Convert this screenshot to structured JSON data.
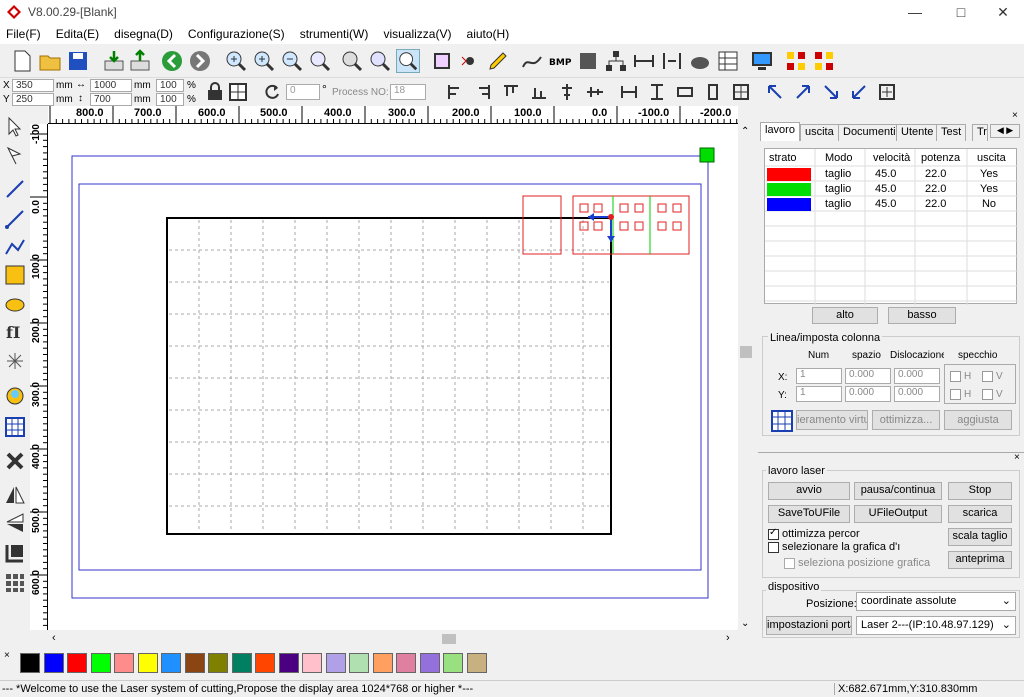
{
  "window": {
    "title": "V8.00.29-[Blank]"
  },
  "menu": [
    "File(F)",
    "Edita(E)",
    "disegna(D)",
    "Configurazione(S)",
    "strumenti(W)",
    "visualizza(V)",
    "aiuto(H)"
  ],
  "toolbar2": {
    "x_label": "X",
    "y_label": "Y",
    "x_val": "350",
    "y_val": "250",
    "unit_mm": "mm",
    "w_val": "1000",
    "h_val": "700",
    "sx_val": "100",
    "sy_val": "100",
    "pct": "%",
    "rotate_val": "0",
    "deg": "°",
    "process_label": "Process NO:",
    "process_val": "18"
  },
  "ruler_top": [
    "800.0",
    "700.0",
    "600.0",
    "500.0",
    "400.0",
    "300.0",
    "200.0",
    "100.0",
    "0.0",
    "-100.0",
    "-200.0"
  ],
  "ruler_left": [
    "-100",
    "0.0",
    "100.0",
    "200.0",
    "300.0",
    "400.0",
    "500.0",
    "600.0"
  ],
  "palette": [
    "#000000",
    "#0000ff",
    "#ff0000",
    "#00ff00",
    "#ff8c8c",
    "#ffff00",
    "#1e90ff",
    "#8b4513",
    "#808000",
    "#008060",
    "#ff4500",
    "#4b0082",
    "#ffc0cb",
    "#b0a0e8",
    "#b0e0b0",
    "#ffa060",
    "#e080a0",
    "#9370db",
    "#98e080",
    "#c8b080"
  ],
  "panel": {
    "tabs": [
      "lavoro",
      "uscita",
      "Documenti",
      "Utente",
      "Test",
      "Tra"
    ],
    "table_headers": [
      "strato",
      "Modo",
      "velocità",
      "potenza",
      "uscita"
    ],
    "layers": [
      {
        "color": "#ff0000",
        "mode": "taglio",
        "speed": "45.0",
        "power": "22.0",
        "out": "Yes"
      },
      {
        "color": "#00dd00",
        "mode": "taglio",
        "speed": "45.0",
        "power": "22.0",
        "out": "Yes"
      },
      {
        "color": "#0000ff",
        "mode": "taglio",
        "speed": "45.0",
        "power": "22.0",
        "out": "No"
      }
    ],
    "btn_up": "alto",
    "btn_down": "basso",
    "array_group": "Linea/imposta colonna",
    "array_headers": [
      "Num",
      "spazio",
      "Dislocazione",
      "specchio"
    ],
    "x_label": "X:",
    "y_label": "Y:",
    "x_num": "1",
    "x_space": "0.000",
    "x_disloc": "0.000",
    "y_num": "1",
    "y_space": "0.000",
    "y_disloc": "0.000",
    "h": "H",
    "v": "V",
    "btn_virtual": "ieramento virtu",
    "btn_optimize": "ottimizza...",
    "btn_adjust": "aggiusta",
    "laser_group": "lavoro laser",
    "btn_start": "avvio",
    "btn_pause": "pausa/continua",
    "btn_stop": "Stop",
    "btn_save_u": "SaveToUFile",
    "btn_ufile": "UFileOutput",
    "btn_download": "scarica",
    "chk_optimize": "ottimizza percor",
    "chk_select_graphic": "selezionare la grafica d'ı",
    "chk_select_pos": "seleziona posizione grafica",
    "btn_scale": "scala taglio",
    "btn_preview": "anteprima",
    "device_group": "dispositivo",
    "pos_label": "Posizione:",
    "pos_value": "coordinate assolute",
    "btn_port": "impostazioni porta",
    "laser_value": "Laser 2---(IP:10.48.97.129)"
  },
  "status": {
    "message": "--- *Welcome to use the Laser system of cutting,Propose the display area 1024*768 or higher *---",
    "coords": "X:682.671mm,Y:310.830mm"
  }
}
